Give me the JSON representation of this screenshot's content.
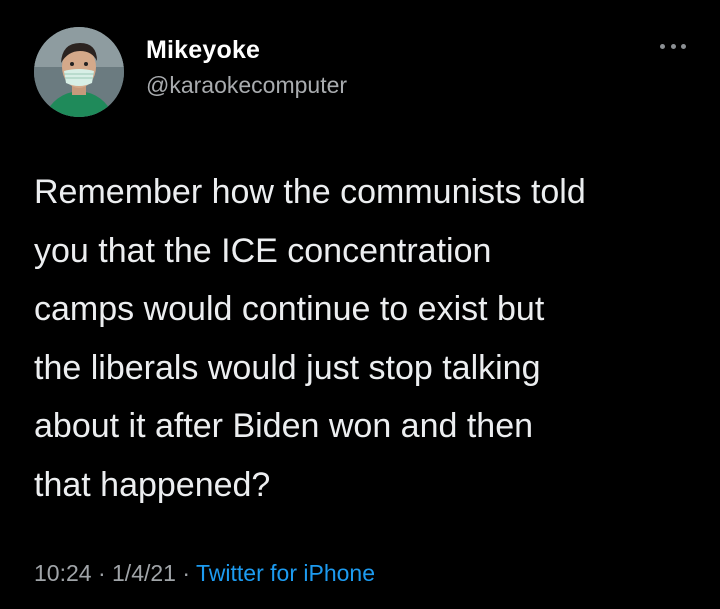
{
  "author": {
    "display_name": "Mikeyoke",
    "handle": "@karaokecomputer",
    "avatar_icon": "user-avatar-masked"
  },
  "tweet": {
    "lines": [
      "Remember how the communists told",
      "you that the ICE concentration",
      "camps would continue to exist but",
      "the liberals would just stop talking",
      "about it after Biden won and then",
      "that happened?"
    ]
  },
  "meta": {
    "time": "10:24",
    "separator": "·",
    "date": "1/4/21",
    "source": "Twitter for iPhone"
  },
  "colors": {
    "background": "#000000",
    "text": "#e7e9ea",
    "secondary": "#a0a4a8",
    "link": "#1d9bf0"
  },
  "icons": {
    "more": "more-horizontal-icon"
  }
}
